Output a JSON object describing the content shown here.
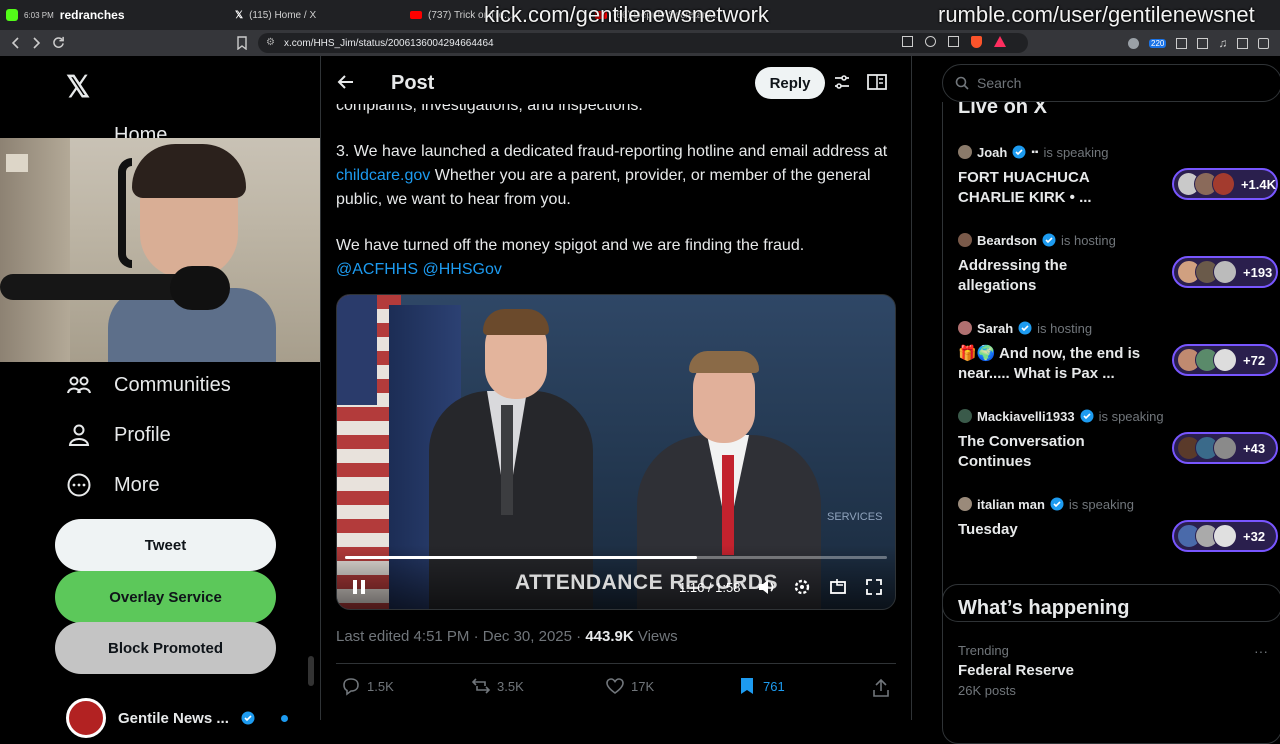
{
  "browser": {
    "tabs": [
      {
        "label": "redranches"
      },
      {
        "label": "(115) Home / X"
      },
      {
        "label": "(737) Trick or Tre..."
      },
      {
        "label": "(66) Deputy Secretary..."
      }
    ],
    "url": "x.com/HHS_Jim/status/2006136004294664464",
    "extension_badge": "220"
  },
  "overlay": {
    "kick_url": "kick.com/gentilenewsnetwork",
    "rumble_url": "rumble.com/user/gentilenewsnet"
  },
  "nav": {
    "home": "Home",
    "communities": "Communities",
    "profile": "Profile",
    "more": "More",
    "tweet_button": "Tweet",
    "overlay_button": "Overlay Service",
    "block_button": "Block Promoted",
    "account_name": "Gentile News ..."
  },
  "header": {
    "title": "Post",
    "reply_button": "Reply"
  },
  "tweet": {
    "line_partial": "complaints, investigations, and inspections.",
    "p3_start": "3. We have launched a dedicated fraud-reporting hotline and email address at ",
    "p3_link": "childcare.gov",
    "p3_end": " Whether you are a parent, provider, or member of the general public, we want to hear from you.",
    "p4": "We have turned off the money spigot and we are finding the fraud.",
    "mention1": "@ACFHHS",
    "mention2": "@HHSGov",
    "video": {
      "caption": "ATTENDANCE RECORDS",
      "time": "1:16 / 1:58",
      "progress": 0.65,
      "bg_text": "SERVICES"
    },
    "edited": "Last edited 4:51 PM · Dec 30, 2025 · ",
    "views_count": "443.9K",
    "views_label": " Views",
    "replies": "1.5K",
    "reposts": "3.5K",
    "likes": "17K",
    "bookmarks": "761"
  },
  "right": {
    "search_placeholder": "Search",
    "live_title": "Live on X",
    "spaces": [
      {
        "host": "Joah",
        "role": "is speaking",
        "title": "FORT HUACHUCA CHARLIE KIRK • ...",
        "count": "+1.4K"
      },
      {
        "host": "Beardson",
        "role": "is hosting",
        "title": "Addressing the allegations",
        "count": "+193"
      },
      {
        "host": "Sarah",
        "role": "is hosting",
        "title": "🎁🌍 And now, the end is near..... What is Pax ...",
        "count": "+72"
      },
      {
        "host": "Mackiavelli1933",
        "role": "is speaking",
        "title": "The Conversation Continues",
        "count": "+43"
      },
      {
        "host": "italian man",
        "role": "is speaking",
        "title": "Tuesday",
        "count": "+32"
      }
    ],
    "whats_happening": "What’s happening",
    "trend_label": "Trending",
    "trend_name": "Federal Reserve",
    "trend_posts": "26K posts"
  },
  "colors": {
    "accent": "#1d9bf0",
    "overlay_green": "#5cc85a",
    "block_gray": "#c4c4c4",
    "spaces_purple": "#7856ff"
  }
}
